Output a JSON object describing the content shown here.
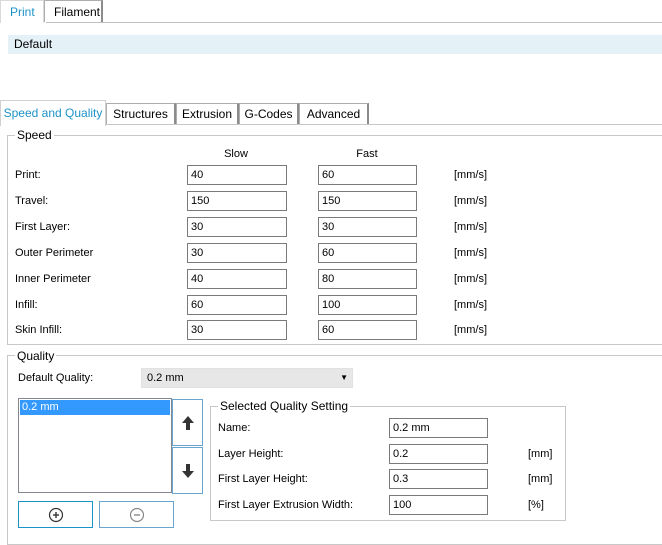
{
  "top_tabs": [
    "Print",
    "Filament"
  ],
  "profile": "Default",
  "sub_tabs": [
    "Speed and Quality",
    "Structures",
    "Extrusion",
    "G-Codes",
    "Advanced"
  ],
  "speed": {
    "title": "Speed",
    "col_slow": "Slow",
    "col_fast": "Fast",
    "rows": [
      {
        "label": "Print:",
        "slow": "40",
        "fast": "60",
        "unit": "[mm/s]"
      },
      {
        "label": "Travel:",
        "slow": "150",
        "fast": "150",
        "unit": "[mm/s]"
      },
      {
        "label": "First Layer:",
        "slow": "30",
        "fast": "30",
        "unit": "[mm/s]"
      },
      {
        "label": "Outer Perimeter",
        "slow": "30",
        "fast": "60",
        "unit": "[mm/s]"
      },
      {
        "label": "Inner Perimeter",
        "slow": "40",
        "fast": "80",
        "unit": "[mm/s]"
      },
      {
        "label": "Infill:",
        "slow": "60",
        "fast": "100",
        "unit": "[mm/s]"
      },
      {
        "label": "Skin Infill:",
        "slow": "30",
        "fast": "60",
        "unit": "[mm/s]"
      }
    ]
  },
  "quality": {
    "title": "Quality",
    "default_label": "Default Quality:",
    "default_value": "0.2 mm",
    "list_items": [
      "0.2 mm"
    ],
    "selected_setting": {
      "title": "Selected Quality Setting",
      "fields": [
        {
          "label": "Name:",
          "value": "0.2 mm",
          "unit": ""
        },
        {
          "label": "Layer Height:",
          "value": "0.2",
          "unit": "[mm]"
        },
        {
          "label": "First Layer Height:",
          "value": "0.3",
          "unit": "[mm]"
        },
        {
          "label": "First Layer Extrusion Width:",
          "value": "100",
          "unit": "[%]"
        }
      ]
    }
  },
  "icons": {
    "move_up": "arrow-up-icon",
    "move_down": "arrow-down-icon",
    "add": "add-circle-icon",
    "remove": "remove-circle-icon"
  },
  "colors": {
    "accent": "#1c93c7",
    "selection": "#3399ff",
    "profile_bar": "#e4f1f6"
  }
}
